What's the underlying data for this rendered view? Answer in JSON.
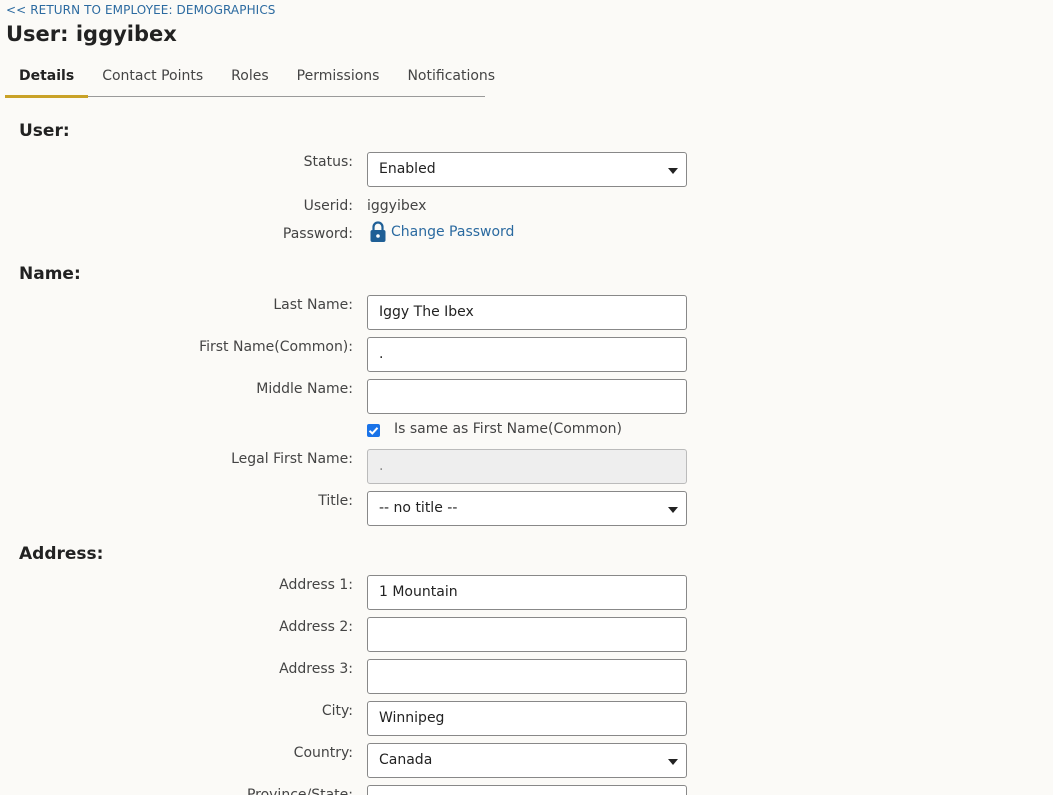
{
  "nav": {
    "return_link": "<< RETURN TO EMPLOYEE: DEMOGRAPHICS"
  },
  "page": {
    "title": "User: iggyibex"
  },
  "tabs": [
    "Details",
    "Contact Points",
    "Roles",
    "Permissions",
    "Notifications"
  ],
  "active_tab": "Details",
  "user_section": {
    "heading": "User:",
    "status_label": "Status:",
    "status_value": "Enabled",
    "userid_label": "Userid:",
    "userid_value": "iggyibex",
    "password_label": "Password:",
    "change_password": "Change Password"
  },
  "name_section": {
    "heading": "Name:",
    "last_name_label": "Last Name:",
    "last_name_value": "Iggy The Ibex",
    "first_name_label": "First Name(Common):",
    "first_name_value": ".",
    "middle_name_label": "Middle Name:",
    "middle_name_value": "",
    "same_as_label": "Is same as First Name(Common)",
    "same_as_checked": true,
    "legal_first_label": "Legal First Name:",
    "legal_first_value": ".",
    "title_label": "Title:",
    "title_value": "-- no title --"
  },
  "address_section": {
    "heading": "Address:",
    "address1_label": "Address 1:",
    "address1_value": "1 Mountain",
    "address2_label": "Address 2:",
    "address2_value": "",
    "address3_label": "Address 3:",
    "address3_value": "",
    "city_label": "City:",
    "city_value": "Winnipeg",
    "country_label": "Country:",
    "country_value": "Canada",
    "province_label": "Province/State:"
  },
  "colors": {
    "link": "#2b6aa0",
    "tab_accent": "#c9a227",
    "checkbox": "#1a73e8"
  }
}
